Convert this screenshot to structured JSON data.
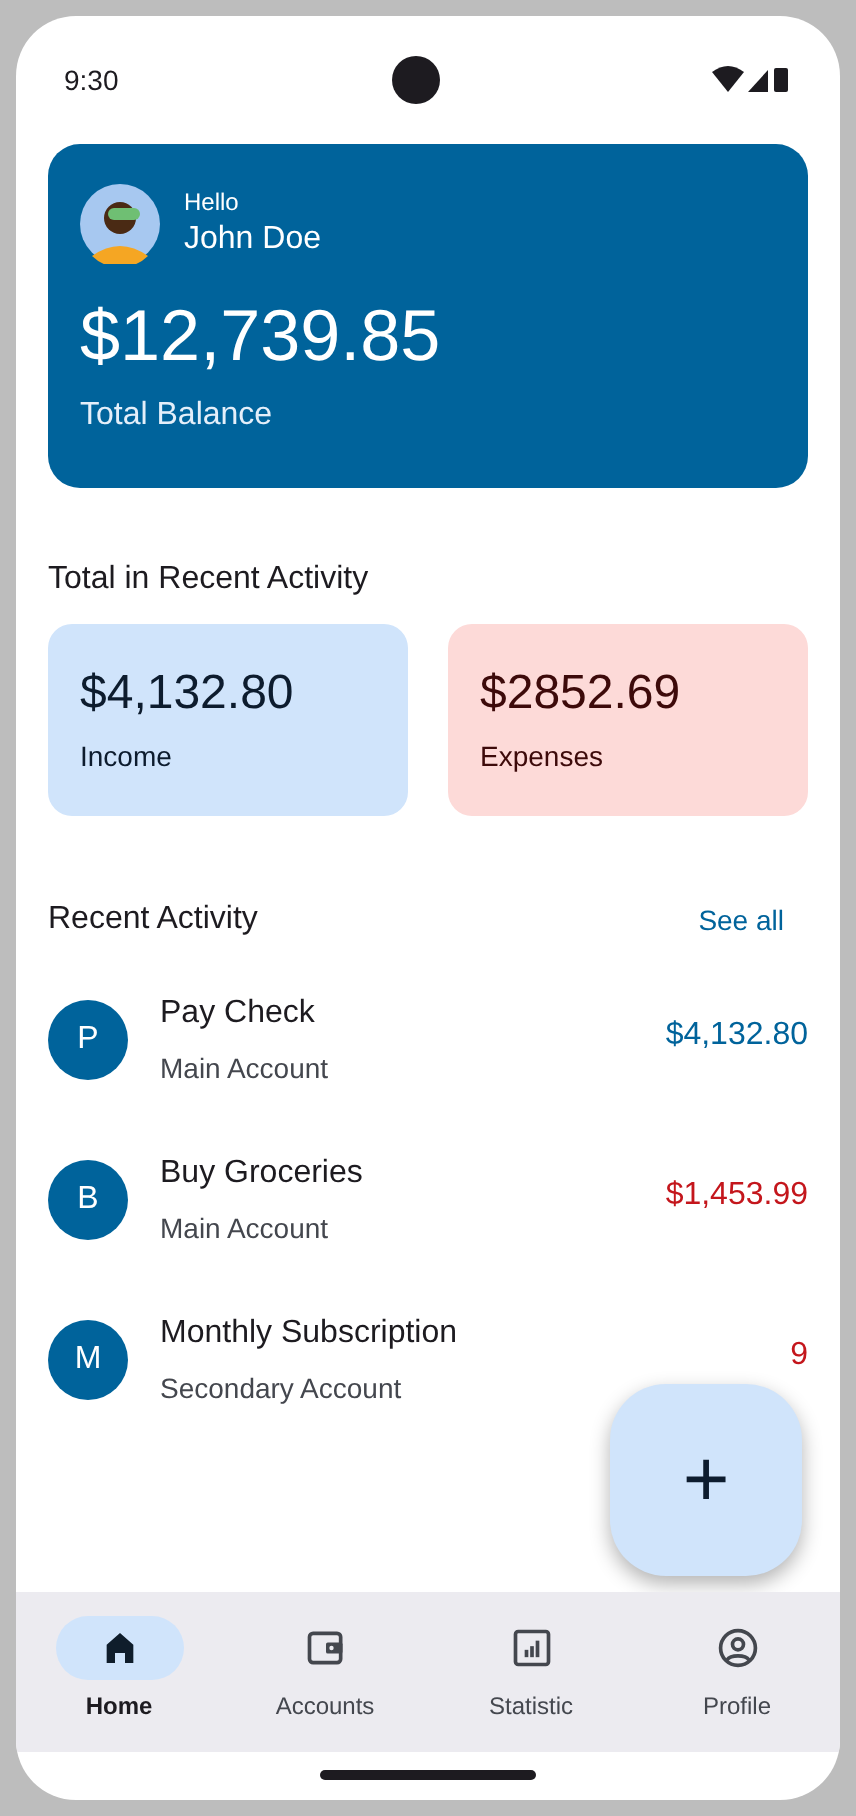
{
  "status_bar": {
    "time": "9:30"
  },
  "balance_card": {
    "greeting": "Hello",
    "name": "John Doe",
    "amount": "$12,739.85",
    "label": "Total Balance"
  },
  "summary": {
    "title": "Total in Recent Activity",
    "cards": [
      {
        "kind": "income",
        "amount": "$4,132.80",
        "label": "Income"
      },
      {
        "kind": "expense",
        "amount": "$2852.69",
        "label": "Expenses"
      }
    ]
  },
  "recent_activity": {
    "title": "Recent Activity",
    "see_all": "See all",
    "items": [
      {
        "initial": "P",
        "title": "Pay Check",
        "account": "Main Account",
        "amount": "$4,132.80",
        "kind": "income"
      },
      {
        "initial": "B",
        "title": "Buy Groceries",
        "account": "Main Account",
        "amount": "$1,453.99",
        "kind": "expense"
      },
      {
        "initial": "M",
        "title": "Monthly Subscription",
        "account": "Secondary Account",
        "amount": "9",
        "kind": "expense"
      }
    ]
  },
  "fab": {
    "label": "+"
  },
  "nav": [
    {
      "label": "Home",
      "kind": "home",
      "selected": true
    },
    {
      "label": "Accounts",
      "kind": "wallet",
      "selected": false
    },
    {
      "label": "Statistic",
      "kind": "chart",
      "selected": false
    },
    {
      "label": "Profile",
      "kind": "profile",
      "selected": false
    }
  ]
}
